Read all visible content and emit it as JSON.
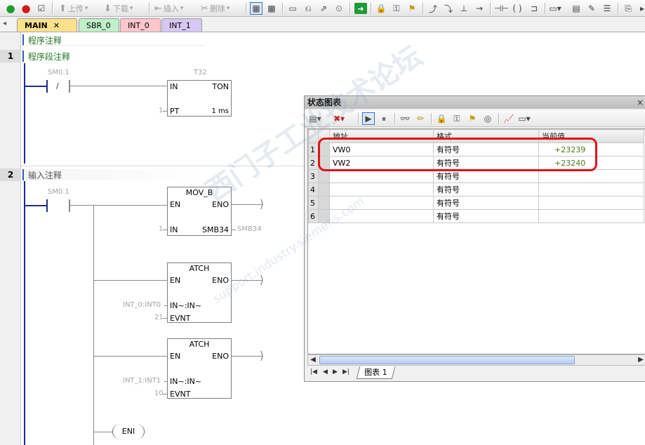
{
  "toolbar": {
    "upload_label": "上传",
    "download_label": "下载",
    "insert_label": "插入",
    "delete_label": "删除"
  },
  "tabs": [
    {
      "label": "MAIN",
      "close": "✕"
    },
    {
      "label": "SBR_0"
    },
    {
      "label": "INT_0"
    },
    {
      "label": "INT_1"
    }
  ],
  "editor": {
    "program_comment": "程序注释",
    "networks": [
      {
        "number": "1",
        "comment": "程序段注释"
      },
      {
        "number": "2",
        "comment": "输入注释"
      }
    ],
    "net1": {
      "contact": "SM0.1",
      "contact_symbol": "/",
      "timer_name": "T32",
      "timer_in": "IN",
      "timer_type": "TON",
      "pt_value": "1",
      "pt_label": "PT",
      "pt_unit": "1 ms"
    },
    "net2": {
      "contact": "SM0.1",
      "mov_title": "MOV_B",
      "en": "EN",
      "eno": "ENO",
      "mov_in_value": "1",
      "mov_in_label": "IN",
      "mov_out_label": "SMB34",
      "mov_out_value": "SMB34",
      "atch1_title": "ATCH",
      "atch1_int_value": "INT_0:INT0",
      "atch1_int_label": "IN~:IN~",
      "atch1_evnt_value": "21",
      "atch1_evnt_label": "EVNT",
      "atch2_title": "ATCH",
      "atch2_int_value": "INT_1:INT1",
      "atch2_int_label": "IN~:IN~",
      "atch2_evnt_value": "10",
      "atch2_evnt_label": "EVNT",
      "eni_label": "ENI"
    }
  },
  "status_chart": {
    "title": "状态图表",
    "close": "×",
    "columns": [
      "地址",
      "格式",
      "当前值"
    ],
    "rows": [
      {
        "n": "1",
        "address": "VW0",
        "format": "有符号",
        "value": "+23239"
      },
      {
        "n": "2",
        "address": "VW2",
        "format": "有符号",
        "value": "+23240"
      },
      {
        "n": "3",
        "address": "",
        "format": "有符号",
        "value": ""
      },
      {
        "n": "4",
        "address": "",
        "format": "有符号",
        "value": ""
      },
      {
        "n": "5",
        "address": "",
        "format": "有符号",
        "value": ""
      },
      {
        "n": "6",
        "address": "",
        "format": "有符号",
        "value": ""
      }
    ],
    "sheet_tab": "图表 1"
  },
  "watermark": {
    "main": "西门子工业技术论坛",
    "url": "support.industry.siemens.com"
  },
  "colors": {
    "rail": "#1b2e8a",
    "value_green": "#4d7a1c",
    "highlight_red": "#e0141b",
    "main_tab": "#fde18a"
  }
}
